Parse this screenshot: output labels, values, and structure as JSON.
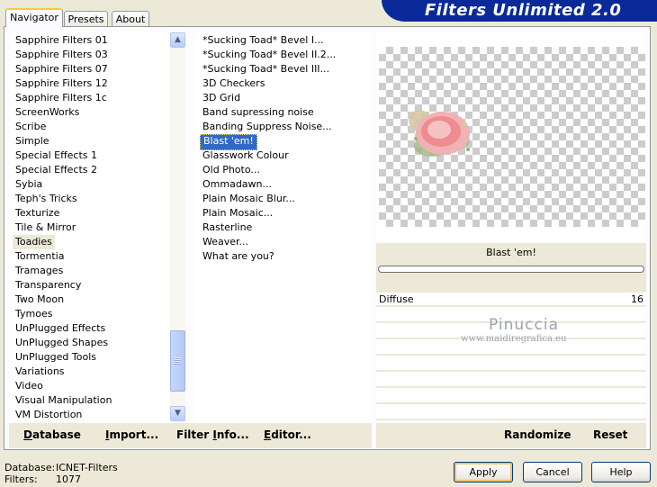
{
  "tabs": [
    "Navigator",
    "Presets",
    "About"
  ],
  "title": "Filters Unlimited 2.0",
  "categories": [
    "Sapphire Filters 01",
    "Sapphire Filters 03",
    "Sapphire Filters 07",
    "Sapphire Filters 12",
    "Sapphire Filters 1c",
    "ScreenWorks",
    "Scribe",
    "Simple",
    "Special Effects 1",
    "Special Effects 2",
    "Sybia",
    "Teph's Tricks",
    "Texturize",
    "Tile & Mirror",
    "Toadies",
    "Tormentia",
    "Tramages",
    "Transparency",
    "Two Moon",
    "Tymoes",
    "UnPlugged Effects",
    "UnPlugged Shapes",
    "UnPlugged Tools",
    "Variations",
    "Video",
    "Visual Manipulation",
    "VM Distortion"
  ],
  "selected_category": "Toadies",
  "filters": [
    "*Sucking Toad*  Bevel I...",
    "*Sucking Toad*  Bevel II.2...",
    "*Sucking Toad*  Bevel III...",
    "3D Checkers",
    "3D Grid",
    "Band supressing noise",
    "Banding Suppress Noise...",
    "Blast 'em!",
    "Glasswork Colour",
    "Old Photo...",
    "Ommadawn...",
    "Plain Mosaic Blur...",
    "Plain Mosaic...",
    "Rasterline",
    "Weaver...",
    "What are you?"
  ],
  "selected_filter": "Blast 'em!",
  "preview": {
    "filter_label": "Blast 'em!",
    "progress": 0,
    "watermark_name": "Pinuccia",
    "watermark_url": "www.maidiregrafica.eu"
  },
  "params": [
    {
      "name": "Diffuse",
      "value": "16"
    }
  ],
  "toolbar_left": {
    "database": "Database",
    "import": "Import...",
    "filter_info": "Filter Info...",
    "editor": "Editor..."
  },
  "toolbar_right": {
    "randomize": "Randomize",
    "reset": "Reset"
  },
  "status": {
    "database_label": "Database:",
    "database_value": "ICNET-Filters",
    "filters_label": "Filters:",
    "filters_value": "1077"
  },
  "buttons": {
    "apply": "Apply",
    "cancel": "Cancel",
    "help": "Help"
  },
  "colors": {
    "banner": "#0a2a9a",
    "selection": "#316ac5",
    "panel": "#ece9d8"
  }
}
